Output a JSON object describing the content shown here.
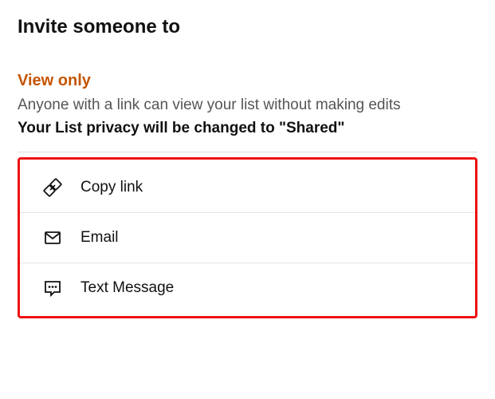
{
  "header": {
    "title": "Invite someone to",
    "subtitle": "View only",
    "description": "Anyone with a link can view your list without making edits",
    "notice": "Your List privacy will be changed to \"Shared\""
  },
  "share_options": [
    {
      "id": "copy-link",
      "label": "Copy link",
      "icon": "link-icon"
    },
    {
      "id": "email",
      "label": "Email",
      "icon": "email-icon"
    },
    {
      "id": "text-message",
      "label": "Text Message",
      "icon": "message-icon"
    }
  ]
}
